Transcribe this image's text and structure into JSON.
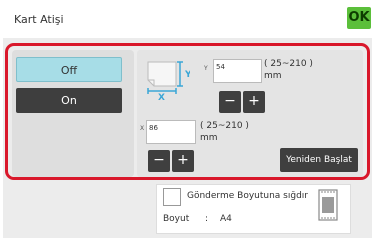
{
  "header": {
    "title": "Kart Atişi",
    "ok_label": "OK"
  },
  "mode": {
    "off_label": "Off",
    "on_label": "On",
    "selected": "Off"
  },
  "y_dimension": {
    "axis_label": "Y",
    "value": "54",
    "range_text": "( 25~210 )",
    "unit": "mm",
    "minus_label": "−",
    "plus_label": "+"
  },
  "x_dimension": {
    "axis_label": "X",
    "value": "86",
    "range_text": "( 25~210 )",
    "unit": "mm",
    "minus_label": "−",
    "plus_label": "+"
  },
  "restart_label": "Yeniden Başlat",
  "fit": {
    "label": "Gönderme Boyutuna sığdır",
    "size_label": "Boyut",
    "size_separator": ":",
    "size_value": "A4"
  },
  "diagram": {
    "y_letter": "Y",
    "x_letter": "X"
  },
  "colors": {
    "ok": "#5bbf3a",
    "highlight_frame": "#d9182b",
    "selected_option": "#a7dde7",
    "dark_button": "#3f3f3f"
  }
}
